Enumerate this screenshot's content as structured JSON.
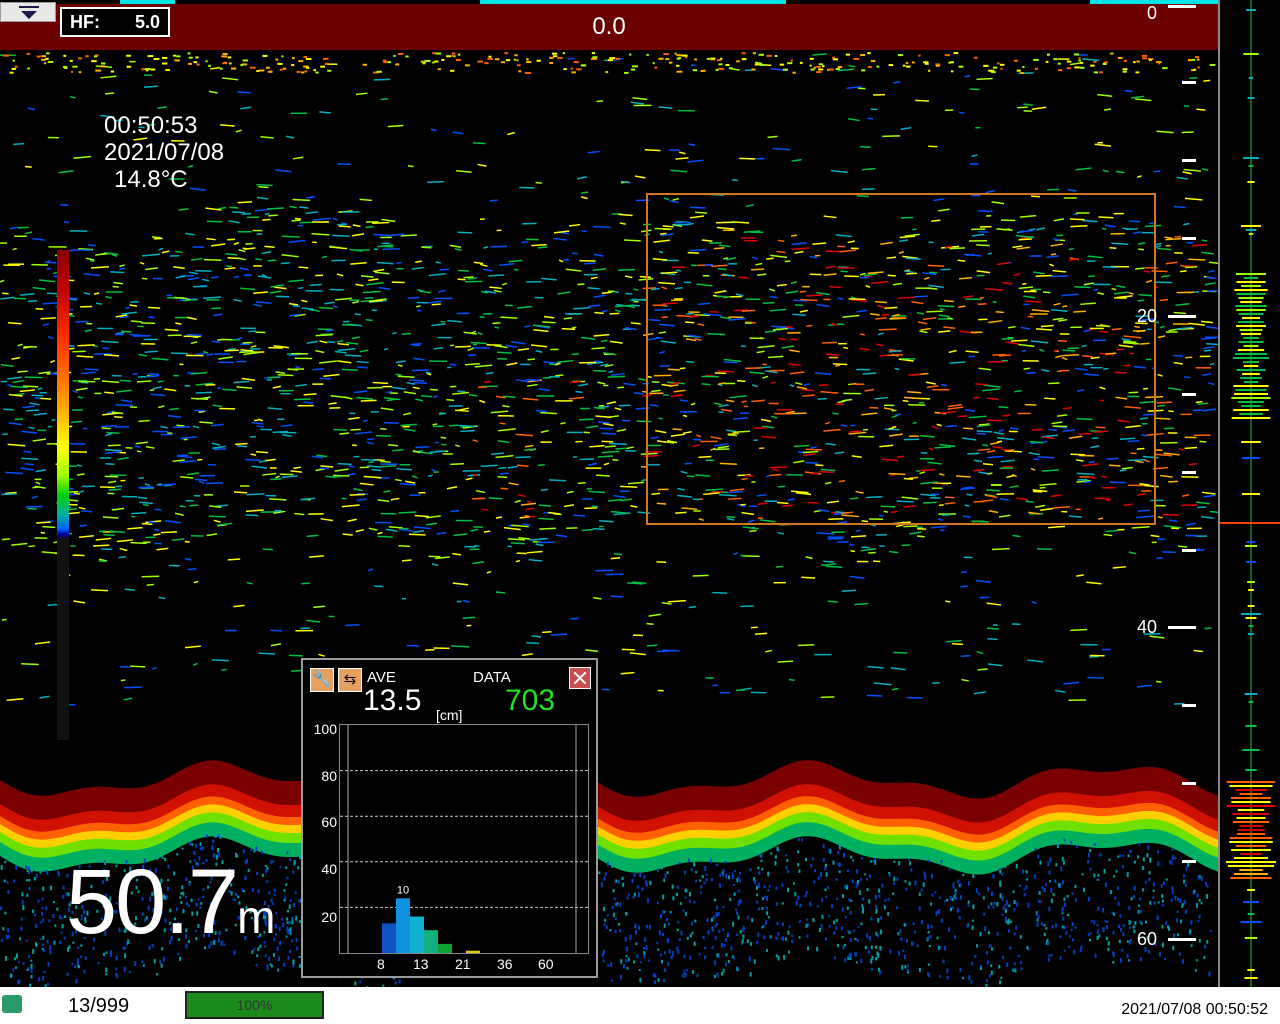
{
  "header": {
    "hf_label": "HF:",
    "hf_value": "5.0",
    "center_value": "0.0"
  },
  "info": {
    "time": "00:50:53",
    "date": "2021/07/08",
    "temperature": "14.8°C"
  },
  "depth_axis": {
    "labels": [
      "0",
      "20",
      "40",
      "60"
    ]
  },
  "depth_readout": {
    "value": "50.7",
    "unit": "m"
  },
  "histogram_panel": {
    "ave_label": "AVE",
    "ave_value": "13.5",
    "unit": "[cm]",
    "data_label": "DATA",
    "data_value": "703",
    "peak_label": "10",
    "y_ticks": [
      "100",
      "80",
      "60",
      "40",
      "20"
    ],
    "x_ticks": [
      "8",
      "13",
      "21",
      "36",
      "60"
    ],
    "bars": [
      {
        "value": 13,
        "color": "#1050c0"
      },
      {
        "value": 24,
        "color": "#1090e0"
      },
      {
        "value": 16,
        "color": "#10b0d0"
      },
      {
        "value": 10,
        "color": "#10b080"
      },
      {
        "value": 4,
        "color": "#10a030"
      },
      {
        "value": 0,
        "color": "#209010"
      },
      {
        "value": 1,
        "color": "#e0d000"
      }
    ],
    "wrench_icon": "wrench-icon",
    "swap_icon": "swap-arrows-icon",
    "close_icon": "close-icon"
  },
  "status_bar": {
    "count": "13/999",
    "progress_text": "100%",
    "progress_fraction": 1.0,
    "timestamp": "2021/07/08 00:50:52"
  },
  "colors": {
    "header_bg": "#6b0000",
    "selection": "#d07820",
    "data_green": "#22e022"
  }
}
